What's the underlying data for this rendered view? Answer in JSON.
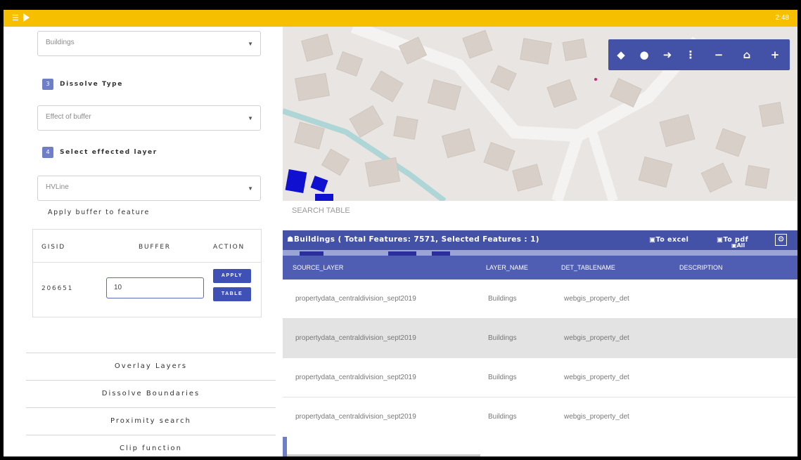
{
  "topbar": {
    "menu_icon": "menu-icon",
    "play_icon": "play-icon",
    "time": "2:48"
  },
  "sidebar": {
    "layer_select": "Buildings",
    "dissolve": {
      "step": "3",
      "label": "Dissolve Type",
      "value": "Effect of buffer"
    },
    "affected": {
      "step": "4",
      "label": "Select effected layer",
      "value": "HVLine"
    },
    "apply_title": "Apply buffer to feature",
    "buffer_table": {
      "headers": [
        "GISID",
        "BUFFER",
        "ACTION"
      ],
      "gisid": "206651",
      "buffer_value": "10",
      "apply_label": "APPLY",
      "table_label": "TABLE"
    },
    "accordion": [
      "Overlay Layers",
      "Dissolve Boundaries",
      "Proximity search",
      "Clip function"
    ]
  },
  "map": {
    "tools": [
      "eraser-icon",
      "marker-icon",
      "sign-in-icon",
      "more-vertical-icon",
      "zoom-out-icon",
      "home-icon",
      "zoom-in-icon"
    ],
    "tool_glyphs": [
      "◆",
      "●",
      "➜",
      "⋮",
      "−",
      "⌂",
      "+"
    ]
  },
  "table": {
    "search_label": "SEARCH TABLE",
    "title": "Buildings ( Total Features: 7571, Selected Features : 1)",
    "to_excel": "To excel",
    "to_pdf": "To pdf",
    "all": "All",
    "columns": [
      "SOURCE_LAYER",
      "LAYER_NAME",
      "DET_TABLENAME",
      "DESCRIPTION"
    ],
    "rows": [
      [
        "propertydata_centraldivision_sept2019",
        "Buildings",
        "webgis_property_det",
        ""
      ],
      [
        "propertydata_centraldivision_sept2019",
        "Buildings",
        "webgis_property_det",
        ""
      ],
      [
        "propertydata_centraldivision_sept2019",
        "Buildings",
        "webgis_property_det",
        ""
      ],
      [
        "propertydata_centraldivision_sept2019",
        "Buildings",
        "webgis_property_det",
        ""
      ]
    ]
  },
  "colors": {
    "accent": "#3f51b5",
    "topbar": "#f6c000",
    "map_bg": "#e9e5e2",
    "building": "#d8d0c8",
    "selected": "#1010d0"
  }
}
